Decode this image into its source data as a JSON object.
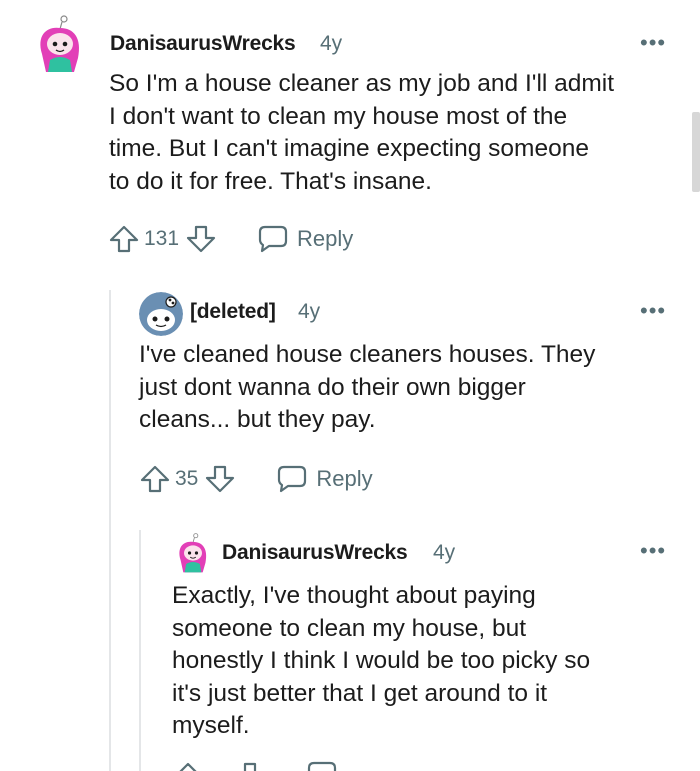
{
  "comments": [
    {
      "username": "DanisaurusWrecks",
      "age": "4y",
      "more": "•••",
      "body_lines": [
        "So I'm a house cleaner as my job and I'll admit",
        "I don't want to clean my house most of the",
        "time. But I can't imagine expecting someone",
        "to do it for free. That's insane."
      ],
      "votes": "131",
      "reply_label": "Reply",
      "avatar_icon": "pink-hair-snoo-avatar-icon"
    },
    {
      "username": "[deleted]",
      "age": "4y",
      "more": "•••",
      "body_lines": [
        "I've cleaned house cleaners houses. They",
        "just dont wanna do their own bigger",
        "cleans... but they pay."
      ],
      "votes": "35",
      "reply_label": "Reply",
      "avatar_icon": "default-snoo-avatar-icon"
    },
    {
      "username": "DanisaurusWrecks",
      "age": "4y",
      "more": "•••",
      "body_lines": [
        "Exactly, I've thought about paying",
        "someone to clean my house, but",
        "honestly I think I would be too picky so",
        "it's just better that I get around to it",
        "myself."
      ],
      "avatar_icon": "pink-hair-snoo-avatar-icon"
    }
  ],
  "colors": {
    "text": "#1c1c1c",
    "meta": "#576f76",
    "thread_line": "#e4e6e8",
    "avatar_hair": "#e23fb7",
    "avatar_shirt": "#2fc1a0",
    "default_avatar": "#6a8fb3"
  }
}
